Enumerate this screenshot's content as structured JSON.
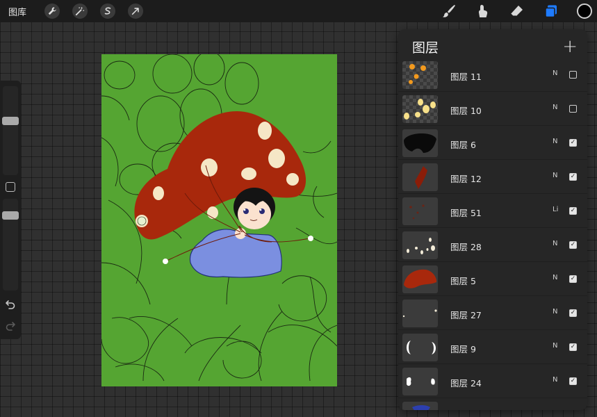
{
  "topbar": {
    "gallery_label": "图库",
    "left_tools": [
      "wrench-icon",
      "magic-wand-icon",
      "selection-icon",
      "transform-arrow-icon"
    ],
    "right_tools": [
      "brush-icon",
      "smudge-icon",
      "eraser-icon",
      "layers-icon"
    ],
    "current_color": "#000000",
    "active_tool_color": "#1e7bff"
  },
  "layers_panel": {
    "title": "图层",
    "add_label": "+",
    "layers": [
      {
        "name": "图层 11",
        "mode": "N",
        "visible": false
      },
      {
        "name": "图层 10",
        "mode": "N",
        "visible": false
      },
      {
        "name": "图层 6",
        "mode": "N",
        "visible": true
      },
      {
        "name": "图层 12",
        "mode": "N",
        "visible": true
      },
      {
        "name": "图层 51",
        "mode": "Li",
        "visible": true
      },
      {
        "name": "图层 28",
        "mode": "N",
        "visible": true
      },
      {
        "name": "图层 5",
        "mode": "N",
        "visible": true
      },
      {
        "name": "图层 27",
        "mode": "N",
        "visible": true
      },
      {
        "name": "图层 9",
        "mode": "N",
        "visible": true
      },
      {
        "name": "图层 24",
        "mode": "N",
        "visible": true
      }
    ]
  },
  "sidebar": {
    "brush_size_level": 0.62,
    "opacity_level": 0.85
  },
  "colors": {
    "canvas_green": "#55a532",
    "mushroom_red": "#a8280c",
    "sweater_blue": "#7b8fe0"
  }
}
